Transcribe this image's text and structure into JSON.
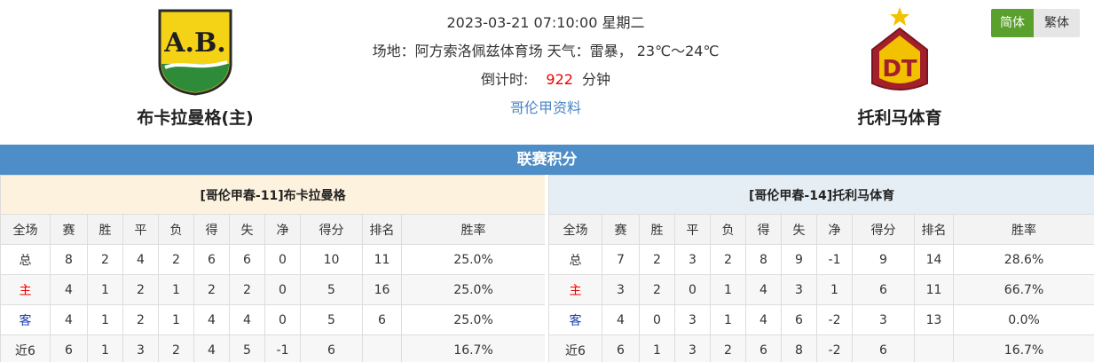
{
  "match": {
    "datetime": "2023-03-21 07:10:00 星期二",
    "venue_line": "场地：阿方索洛佩兹体育场 天气：雷暴， 23℃～24℃",
    "countdown_label": "倒计时:",
    "countdown_value": "922",
    "countdown_unit": "分钟",
    "league_link": "哥伦甲资料"
  },
  "home": {
    "name": "布卡拉曼格(主)",
    "logo_text": "A.B."
  },
  "away": {
    "name": "托利马体育",
    "logo_text": "DT"
  },
  "lang": {
    "simplified": "简体",
    "traditional": "繁体"
  },
  "section_title": "联赛积分",
  "columns": [
    "全场",
    "赛",
    "胜",
    "平",
    "负",
    "得",
    "失",
    "净",
    "得分",
    "排名",
    "胜率"
  ],
  "home_table": {
    "caption": "[哥伦甲春-11]布卡拉曼格",
    "rows": [
      [
        "总",
        "8",
        "2",
        "4",
        "2",
        "6",
        "6",
        "0",
        "10",
        "11",
        "25.0%"
      ],
      [
        "主",
        "4",
        "1",
        "2",
        "1",
        "2",
        "2",
        "0",
        "5",
        "16",
        "25.0%"
      ],
      [
        "客",
        "4",
        "1",
        "2",
        "1",
        "4",
        "4",
        "0",
        "5",
        "6",
        "25.0%"
      ],
      [
        "近6",
        "6",
        "1",
        "3",
        "2",
        "4",
        "5",
        "-1",
        "6",
        "",
        "16.7%"
      ]
    ]
  },
  "away_table": {
    "caption": "[哥伦甲春-14]托利马体育",
    "rows": [
      [
        "总",
        "7",
        "2",
        "3",
        "2",
        "8",
        "9",
        "-1",
        "9",
        "14",
        "28.6%"
      ],
      [
        "主",
        "3",
        "2",
        "0",
        "1",
        "4",
        "3",
        "1",
        "6",
        "11",
        "66.7%"
      ],
      [
        "客",
        "4",
        "0",
        "3",
        "1",
        "4",
        "6",
        "-2",
        "3",
        "13",
        "0.0%"
      ],
      [
        "近6",
        "6",
        "1",
        "3",
        "2",
        "6",
        "8",
        "-2",
        "6",
        "",
        "16.7%"
      ]
    ]
  },
  "colors": {
    "section_bar": "#4d8dc8",
    "home_label": "#e00000",
    "away_label": "#1a3fb0",
    "lang_active": "#5aa02c"
  }
}
